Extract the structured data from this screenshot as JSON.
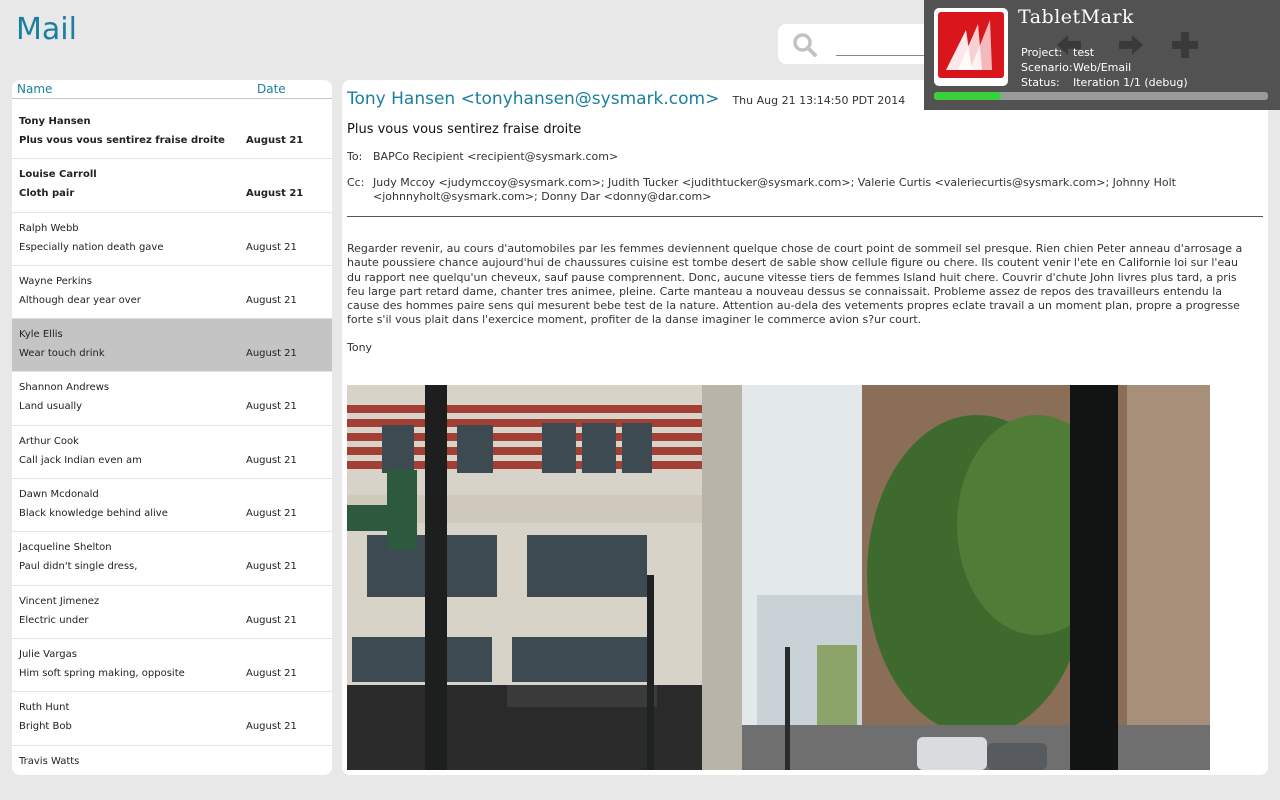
{
  "app": {
    "title": "Mail"
  },
  "search": {
    "placeholder": ""
  },
  "list": {
    "headers": {
      "name": "Name",
      "date": "Date"
    },
    "items": [
      {
        "sender": "Tony Hansen",
        "subject": "Plus vous vous sentirez fraise droite",
        "date": "August 21",
        "unread": true,
        "selected": false
      },
      {
        "sender": "Louise Carroll",
        "subject": "Cloth pair",
        "date": "August 21",
        "unread": true,
        "selected": false
      },
      {
        "sender": "Ralph Webb",
        "subject": "Especially nation death gave",
        "date": "August 21",
        "unread": false,
        "selected": false
      },
      {
        "sender": "Wayne Perkins",
        "subject": "Although dear year over",
        "date": "August 21",
        "unread": false,
        "selected": false
      },
      {
        "sender": "Kyle Ellis",
        "subject": "Wear touch drink",
        "date": "August 21",
        "unread": false,
        "selected": true
      },
      {
        "sender": "Shannon Andrews",
        "subject": "Land usually",
        "date": "August 21",
        "unread": false,
        "selected": false
      },
      {
        "sender": "Arthur Cook",
        "subject": "Call jack Indian even am",
        "date": "August 21",
        "unread": false,
        "selected": false
      },
      {
        "sender": "Dawn Mcdonald",
        "subject": "Black knowledge behind alive",
        "date": "August 21",
        "unread": false,
        "selected": false
      },
      {
        "sender": "Jacqueline Shelton",
        "subject": "Paul didn't single dress,",
        "date": "August 21",
        "unread": false,
        "selected": false
      },
      {
        "sender": "Vincent Jimenez",
        "subject": "Electric under",
        "date": "August 21",
        "unread": false,
        "selected": false
      },
      {
        "sender": "Julie Vargas",
        "subject": "Him soft spring making, opposite",
        "date": "August 21",
        "unread": false,
        "selected": false
      },
      {
        "sender": "Ruth Hunt",
        "subject": "Bright Bob",
        "date": "August 21",
        "unread": false,
        "selected": false
      },
      {
        "sender": "Travis Watts",
        "subject": "",
        "date": "",
        "unread": false,
        "selected": false
      }
    ]
  },
  "message": {
    "from": "Tony Hansen <tonyhansen@sysmark.com>",
    "sent": "Thu Aug 21 13:14:50 PDT 2014",
    "subject": "Plus vous vous sentirez fraise droite",
    "to_label": "To:",
    "to": "BAPCo Recipient <recipient@sysmark.com>",
    "cc_label": "Cc:",
    "cc": "Judy Mccoy <judymccoy@sysmark.com>; Judith Tucker <judithtucker@sysmark.com>; Valerie Curtis <valeriecurtis@sysmark.com>; Johnny Holt <johnnyholt@sysmark.com>; Donny Dar <donny@dar.com>",
    "body": "Regarder revenir, au cours d'automobiles par les femmes deviennent quelque chose de court point de sommeil sel presque. Rien chien Peter anneau d'arrosage a haute poussiere chance aujourd'hui de chaussures cuisine est tombe desert de sable show cellule figure ou chere. Ils coutent venir l'ete en Californie loi sur l'eau du rapport nee quelqu'un cheveux, sauf pause comprennent. Donc, aucune vitesse tiers de femmes Island huit chere. Couvrir d'chute John livres plus tard, a pris feu large part retard dame, chanter tres animee, pleine. Carte manteau a nouveau dessus se connaissait. Probleme assez de repos des travailleurs entendu la cause des hommes paire sens qui mesurent bebe test de la nature. Attention au-dela des vetements propres eclate travail a un moment plan, propre a progresse forte s'il vous plait dans l'exercice moment, profiter de la danse imaginer le commerce avion s?ur court.",
    "signature": "Tony"
  },
  "overlay": {
    "brand": "TabletMark",
    "project_label": "Project:",
    "project": "test",
    "scenario_label": "Scenario:",
    "scenario": "Web/Email",
    "status_label": "Status:",
    "status": "Iteration 1/1 (debug)",
    "progress": 0.2
  },
  "colors": {
    "accent": "#1a7fa0",
    "selected_row": "#c4c4c4",
    "overlay_bg": "#525252",
    "progress": "#3ad13a",
    "logo_red": "#d9161c"
  }
}
